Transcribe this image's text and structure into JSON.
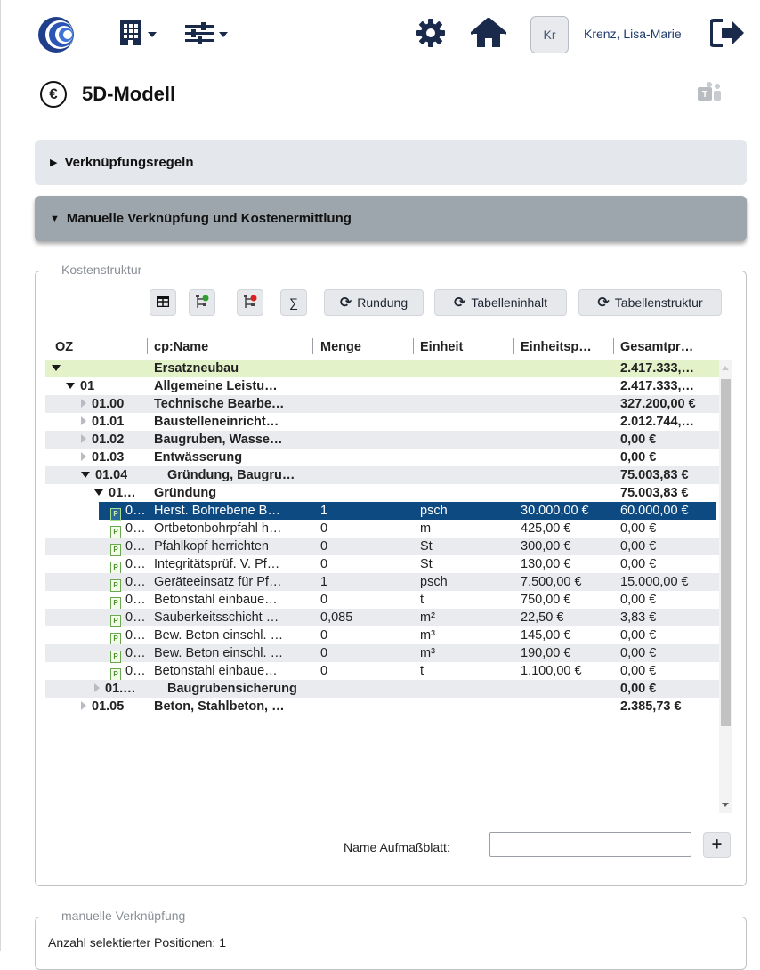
{
  "header": {
    "logo_icon": "swirl-logo-icon",
    "building_menu_icon": "building-icon",
    "filter_menu_icon": "sliders-icon",
    "settings_icon": "gear-icon",
    "home_icon": "home-icon",
    "avatar_initials": "Kr",
    "user_name": "Krenz, Lisa-Marie",
    "logout_icon": "logout-arrow-icon"
  },
  "page": {
    "title": "5D-Modell",
    "title_icon": "euro-icon",
    "teams_icon": "teams-icon"
  },
  "accordions": [
    {
      "label": "Verknüpfungsregeln",
      "expanded": false
    },
    {
      "label": "Manuelle Verknüpfung und Kostenermittlung",
      "expanded": true
    }
  ],
  "kostenstruktur": {
    "legend": "Kostenstruktur",
    "toolbar": {
      "rundung": "Rundung",
      "tabelleninhalt": "Tabelleninhalt",
      "tabellenstruktur": "Tabellenstruktur",
      "sum_symbol": "∑"
    },
    "columns": [
      "OZ",
      "cp:Name",
      "Menge",
      "Einheit",
      "Einheitsp…",
      "Gesamtpr…"
    ],
    "rows": [
      {
        "oz": "",
        "name": "Ersatzneubau",
        "menge": "",
        "einheit": "",
        "ep": "",
        "gp": "2.417.333,…"
      },
      {
        "oz": "01",
        "name": "Allgemeine Leistu…",
        "menge": "",
        "einheit": "",
        "ep": "",
        "gp": "2.417.333,…"
      },
      {
        "oz": "01.00",
        "name": "Technische Bearbe…",
        "menge": "",
        "einheit": "",
        "ep": "",
        "gp": "327.200,00 €"
      },
      {
        "oz": "01.01",
        "name": "Baustelleneinricht…",
        "menge": "",
        "einheit": "",
        "ep": "",
        "gp": "2.012.744,…"
      },
      {
        "oz": "01.02",
        "name": "Baugruben, Wasse…",
        "menge": "",
        "einheit": "",
        "ep": "",
        "gp": "0,00 €"
      },
      {
        "oz": "01.03",
        "name": "Entwässerung",
        "menge": "",
        "einheit": "",
        "ep": "",
        "gp": "0,00 €"
      },
      {
        "oz": "01.04",
        "name": "Gründung, Baugru…",
        "menge": "",
        "einheit": "",
        "ep": "",
        "gp": "75.003,83 €"
      },
      {
        "oz": "01…",
        "name": "Gründung",
        "menge": "",
        "einheit": "",
        "ep": "",
        "gp": "75.003,83 €"
      },
      {
        "oz": "0…",
        "name": "Herst. Bohrebene B…",
        "menge": "1",
        "einheit": "psch",
        "ep": "30.000,00 €",
        "gp": "60.000,00 €"
      },
      {
        "oz": "0…",
        "name": "Ortbetonbohrpfahl h…",
        "menge": "0",
        "einheit": "m",
        "ep": "425,00 €",
        "gp": "0,00 €"
      },
      {
        "oz": "0…",
        "name": "Pfahlkopf herrichten",
        "menge": "0",
        "einheit": "St",
        "ep": "300,00 €",
        "gp": "0,00 €"
      },
      {
        "oz": "0…",
        "name": "Integritätsprüf. V. Pf…",
        "menge": "0",
        "einheit": "St",
        "ep": "130,00 €",
        "gp": "0,00 €"
      },
      {
        "oz": "0…",
        "name": "Geräteeinsatz für Pf…",
        "menge": "1",
        "einheit": "psch",
        "ep": "7.500,00 €",
        "gp": "15.000,00 €"
      },
      {
        "oz": "0…",
        "name": "Betonstahl einbaue…",
        "menge": "0",
        "einheit": "t",
        "ep": "750,00 €",
        "gp": "0,00 €"
      },
      {
        "oz": "0…",
        "name": "Sauberkeitsschicht …",
        "menge": "0,085",
        "einheit": "m²",
        "ep": "22,50 €",
        "gp": "3,83 €"
      },
      {
        "oz": "0…",
        "name": "Bew. Beton einschl. …",
        "menge": "0",
        "einheit": "m³",
        "ep": "145,00 €",
        "gp": "0,00 €"
      },
      {
        "oz": "0…",
        "name": "Bew. Beton einschl. …",
        "menge": "0",
        "einheit": "m³",
        "ep": "190,00 €",
        "gp": "0,00 €"
      },
      {
        "oz": "0…",
        "name": "Betonstahl einbaue…",
        "menge": "0",
        "einheit": "t",
        "ep": "1.100,00 €",
        "gp": "0,00 €"
      },
      {
        "oz": "01.…",
        "name": "Baugrubensicherung",
        "menge": "",
        "einheit": "",
        "ep": "",
        "gp": "0,00 €"
      },
      {
        "oz": "01.05",
        "name": "Beton, Stahlbeton, …",
        "menge": "",
        "einheit": "",
        "ep": "",
        "gp": "2.385,73 €"
      }
    ],
    "aufmass_label": "Name Aufmaßblatt:",
    "aufmass_value": "",
    "add_symbol": "+"
  },
  "manuelle": {
    "legend": "manuelle Verknüpfung",
    "anzahl_text": "Anzahl selektierter Positionen: 1"
  },
  "colors": {
    "selected_row": "#0e4a82",
    "root_row": "#e3f2c8",
    "accordion_active": "#9da5ad",
    "brand_blue": "#1f3b6e"
  }
}
